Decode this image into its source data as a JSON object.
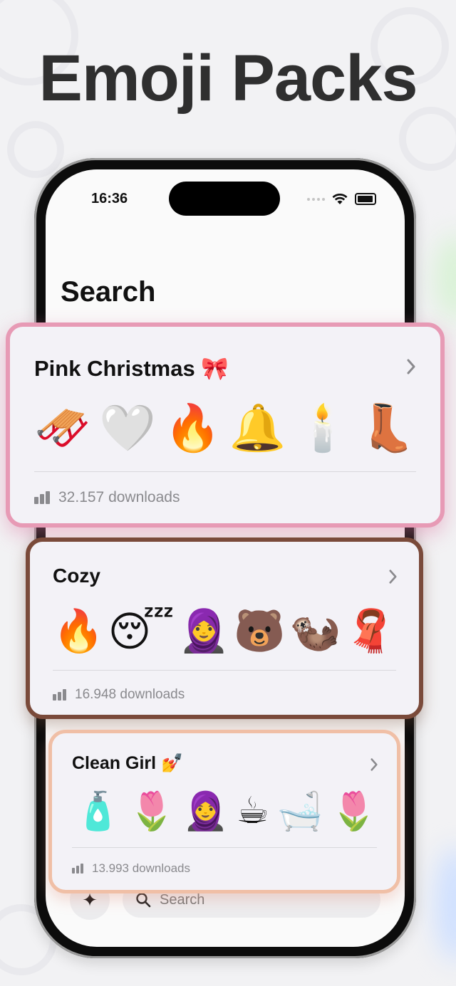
{
  "headline": "Emoji Packs",
  "status_bar": {
    "time": "16:36"
  },
  "screen": {
    "title": "Search"
  },
  "bottom_bar": {
    "search_placeholder": "Search",
    "sparkle_icon": "✦"
  },
  "packs": [
    {
      "title": "Pink Christmas",
      "title_emoji": "🎀",
      "emojis": [
        "🛷",
        "🤍",
        "🔥",
        "🔔",
        "🕯️",
        "👢"
      ],
      "downloads": "32.157 downloads",
      "accent_color": "#e79ab5"
    },
    {
      "title": "Cozy",
      "title_emoji": "",
      "emojis": [
        "🔥",
        "😴",
        "🧕",
        "🐻",
        "🦦",
        "🧣"
      ],
      "downloads": "16.948 downloads",
      "accent_color": "#7a4a3a"
    },
    {
      "title": "Clean Girl",
      "title_emoji": "💅",
      "emojis": [
        "🧴",
        "🌷",
        "🧕",
        "☕",
        "🛁",
        "🌷"
      ],
      "downloads": "13.993 downloads",
      "accent_color": "#f0bfa6"
    }
  ]
}
